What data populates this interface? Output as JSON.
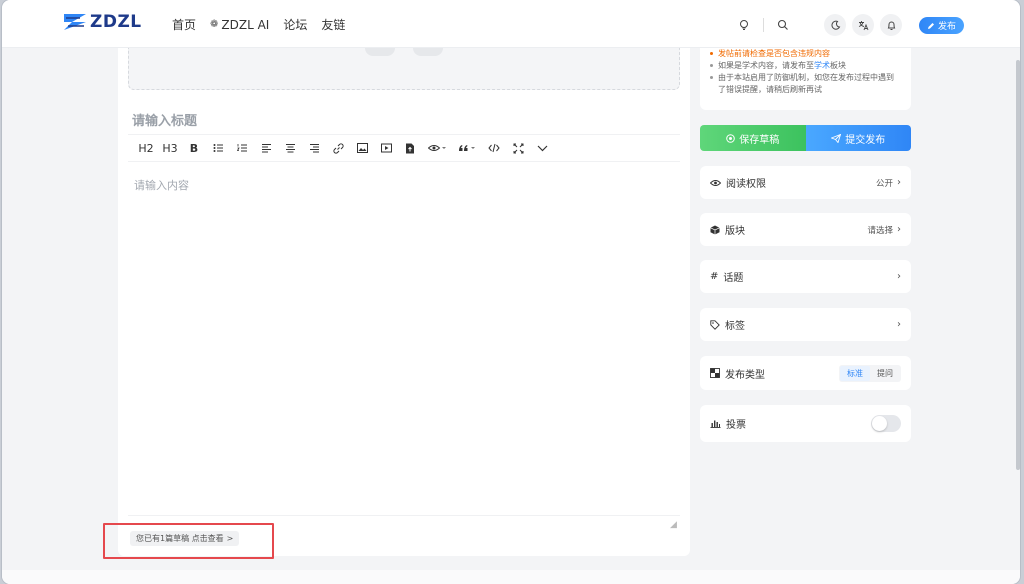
{
  "header": {
    "logo_text": "ZDZL",
    "nav": [
      "首页",
      "ZDZL AI",
      "论坛",
      "友链"
    ],
    "publish_label": "发布"
  },
  "editor": {
    "title_placeholder": "请输入标题",
    "content_placeholder": "请输入内容",
    "toolbar": [
      "H2",
      "H3",
      "B"
    ],
    "draft_notice": "您已有1篇草稿 点击查看",
    "draft_chevron": ">"
  },
  "sidebar": {
    "notices": {
      "warn": "发帖前请检查是否包含违规内容",
      "academic_prefix": "如果是学术内容，请发布至",
      "academic_link": "学术",
      "academic_suffix": "板块",
      "defense": "由于本站启用了防御机制，如您在发布过程中遇到了错误提醒，请稍后刷新再试"
    },
    "save_draft": "保存草稿",
    "submit": "提交发布",
    "read_permission": {
      "label": "阅读权限",
      "value": "公开"
    },
    "section": {
      "label": "版块",
      "value": "请选择"
    },
    "topic": {
      "label": "话题"
    },
    "tags": {
      "label": "标签"
    },
    "publish_type": {
      "label": "发布类型",
      "options": [
        "标准",
        "提问"
      ],
      "selected": "标准"
    },
    "vote": {
      "label": "投票",
      "enabled": false
    }
  },
  "colors": {
    "accent": "#2f86f6",
    "save_green": "#3cc25e",
    "warning": "#f06a00",
    "highlight_box": "#e5484d"
  }
}
